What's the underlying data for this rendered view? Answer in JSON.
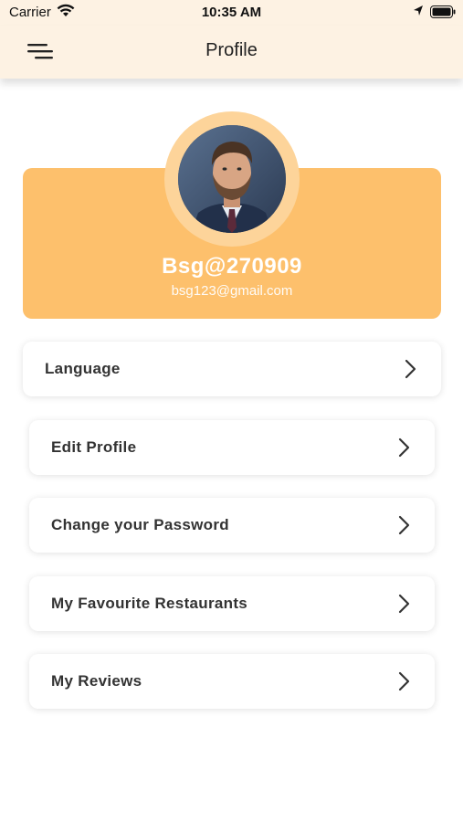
{
  "status_bar": {
    "carrier": "Carrier",
    "time": "10:35 AM",
    "icons": [
      "wifi-icon",
      "location-arrow-icon",
      "battery-icon"
    ]
  },
  "nav": {
    "title": "Profile",
    "menu_icon": "hamburger-menu-icon"
  },
  "profile": {
    "username": "Bsg@270909",
    "email": "bsg123@gmail.com",
    "avatar": "avatar-photo"
  },
  "menu": {
    "items": [
      {
        "label": "Language",
        "icon": "chevron-right-icon"
      },
      {
        "label": "Edit Profile",
        "icon": "chevron-right-icon"
      },
      {
        "label": "Change your Password",
        "icon": "chevron-right-icon"
      },
      {
        "label": "My Favourite Restaurants",
        "icon": "chevron-right-icon"
      },
      {
        "label": "My Reviews",
        "icon": "chevron-right-icon"
      }
    ]
  },
  "colors": {
    "header_bg": "#fdf2e3",
    "card_bg": "#fdc06c",
    "avatar_ring": "#fdd49a",
    "text_dark": "#333333",
    "text_light": "#ffffff"
  }
}
